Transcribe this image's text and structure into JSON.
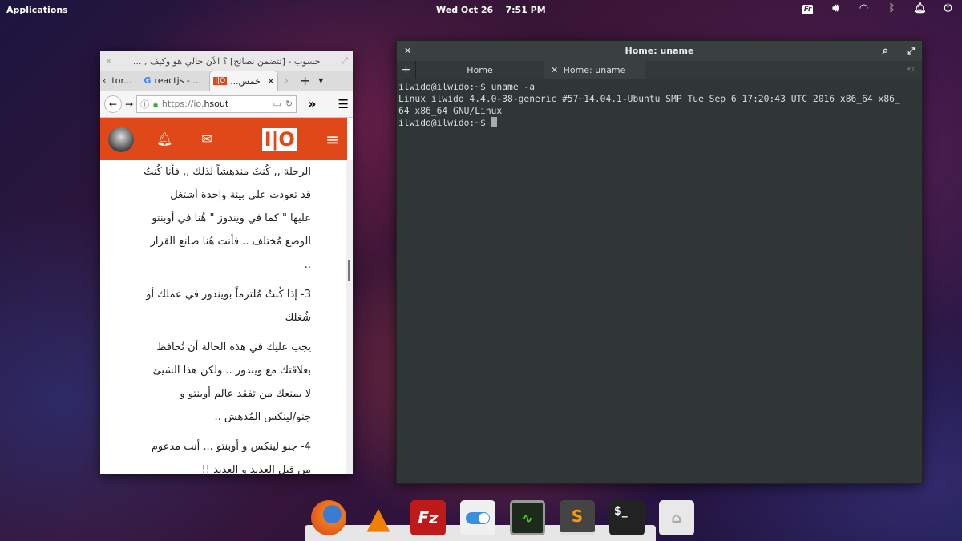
{
  "panel": {
    "applications": "Applications",
    "clock": "Wed Oct 26    7:51 PM",
    "keyboard_layout": "Fr"
  },
  "browser": {
    "window_title": "حسوب - [تتضمن نصائح] ؟ الآن حالي هو وكيف , ...",
    "tabs": [
      {
        "label": "tor..."
      },
      {
        "label": "reactjs - ..."
      },
      {
        "label": "خمس..."
      }
    ],
    "url_prefix": "https://io.",
    "url_host": "hsout",
    "paragraphs": [
      [
        "الرحلة ,, كُنتُ مندهشاً لذلك ,, فأنا كُنتُ",
        "قد تعودت على بيئة واحدة أشتغل",
        "عليها \" كما في ويندوز \" هُنا في أوبنتو",
        "الوضع مُختلف .. فأنت هُنا صانع القرار",
        ".."
      ],
      [
        "3- إذا كُنتُ مُلتزماً بويندوز في عملك أو",
        "شُغلك"
      ],
      [
        "يجب عليك في هذه الحالة أن تُحافظ",
        "بعلاقتك مع ويندوز .. ولكن هذا الشيئ",
        "لا يمنعك من تفقد عالم أوبنتو و",
        "جنو/لينكس المُدهش .."
      ],
      [
        "4- جنو لينكس و أوبنتو ... أنت مدعوم",
        "من قبل العديد و العديد !!"
      ]
    ]
  },
  "terminal": {
    "title": "Home: uname",
    "tabs": [
      {
        "label": "Home"
      },
      {
        "label": "Home: uname"
      }
    ],
    "lines": [
      "ilwido@ilwido:~$ uname -a",
      "Linux ilwido 4.4.0-38-generic #57~14.04.1-Ubuntu SMP Tue Sep 6 17:20:43 UTC 2016 x86_64 x86_",
      "64 x86_64 GNU/Linux",
      "ilwido@ilwido:~$ "
    ]
  },
  "dock": {
    "filezilla": "Fz",
    "sublime": "S",
    "terminal": "$_"
  },
  "colors": {
    "brand": "#e0481a",
    "terminal_bg": "#303536"
  }
}
